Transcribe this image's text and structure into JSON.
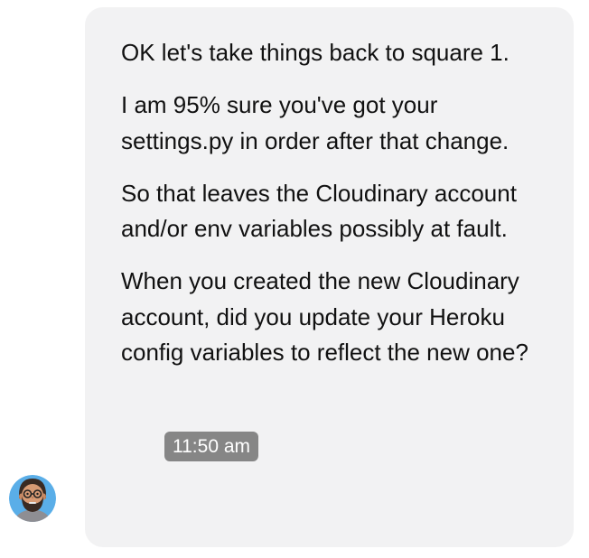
{
  "conversation": {
    "message": {
      "paragraphs": [
        "OK let's take things back to square 1.",
        "I am 95% sure you've got your settings.py in order after that change.",
        "So that leaves the Cloudinary account and/or env variables possibly at fault.",
        "When you created the new Cloudinary account, did you update your Heroku config variables to reflect the new one?"
      ],
      "timestamp": "11:50 am"
    },
    "sender": {
      "avatar_icon": "bearded-man-with-glasses-icon"
    }
  },
  "colors": {
    "bubble_background": "#f2f2f3",
    "text": "#111111",
    "timestamp_background": "#6e6e6e",
    "avatar_background": "#5aaee8"
  }
}
